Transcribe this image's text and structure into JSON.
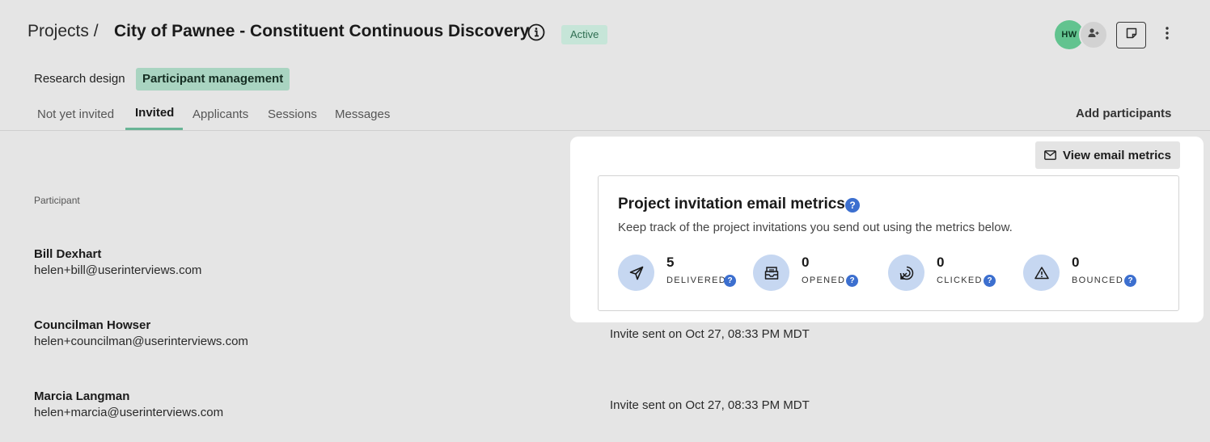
{
  "header": {
    "breadcrumb": "Projects /",
    "title": "City of Pawnee - Constituent Continuous Discovery",
    "status": "Active",
    "avatar_initials": "HW"
  },
  "project_tabs": [
    {
      "label": "Research design",
      "active": false
    },
    {
      "label": "Participant management",
      "active": true
    }
  ],
  "sub_tabs": [
    {
      "label": "Not yet invited",
      "active": false
    },
    {
      "label": "Invited",
      "active": true
    },
    {
      "label": "Applicants",
      "active": false
    },
    {
      "label": "Sessions",
      "active": false
    },
    {
      "label": "Messages",
      "active": false
    }
  ],
  "add_participants_label": "Add participants",
  "table": {
    "column_header": "Participant",
    "rows": [
      {
        "name": "Bill Dexhart",
        "email": "helen+bill@userinterviews.com",
        "invite": ""
      },
      {
        "name": "Councilman Howser",
        "email": "helen+councilman@userinterviews.com",
        "invite": "Invite sent on Oct 27, 08:33 PM MDT"
      },
      {
        "name": "Marcia Langman",
        "email": "helen+marcia@userinterviews.com",
        "invite": "Invite sent on Oct 27, 08:33 PM MDT"
      }
    ]
  },
  "metrics_popover": {
    "button_label": "View email metrics",
    "title": "Project invitation email metrics",
    "subtitle": "Keep track of the project invitations you send out using the metrics below.",
    "help_glyph": "?",
    "metrics": [
      {
        "value": "5",
        "label": "DELIVERED",
        "icon": "send-icon"
      },
      {
        "value": "0",
        "label": "OPENED",
        "icon": "envelope-open-icon"
      },
      {
        "value": "0",
        "label": "CLICKED",
        "icon": "click-target-icon"
      },
      {
        "value": "0",
        "label": "BOUNCED",
        "icon": "warning-icon"
      }
    ]
  },
  "colors": {
    "background": "#e5e5e5",
    "accent_green": "#a9d4c1",
    "active_badge": "#c6e5d8",
    "metric_circle": "#c6d7f1",
    "help_blue": "#3c6fcf"
  }
}
